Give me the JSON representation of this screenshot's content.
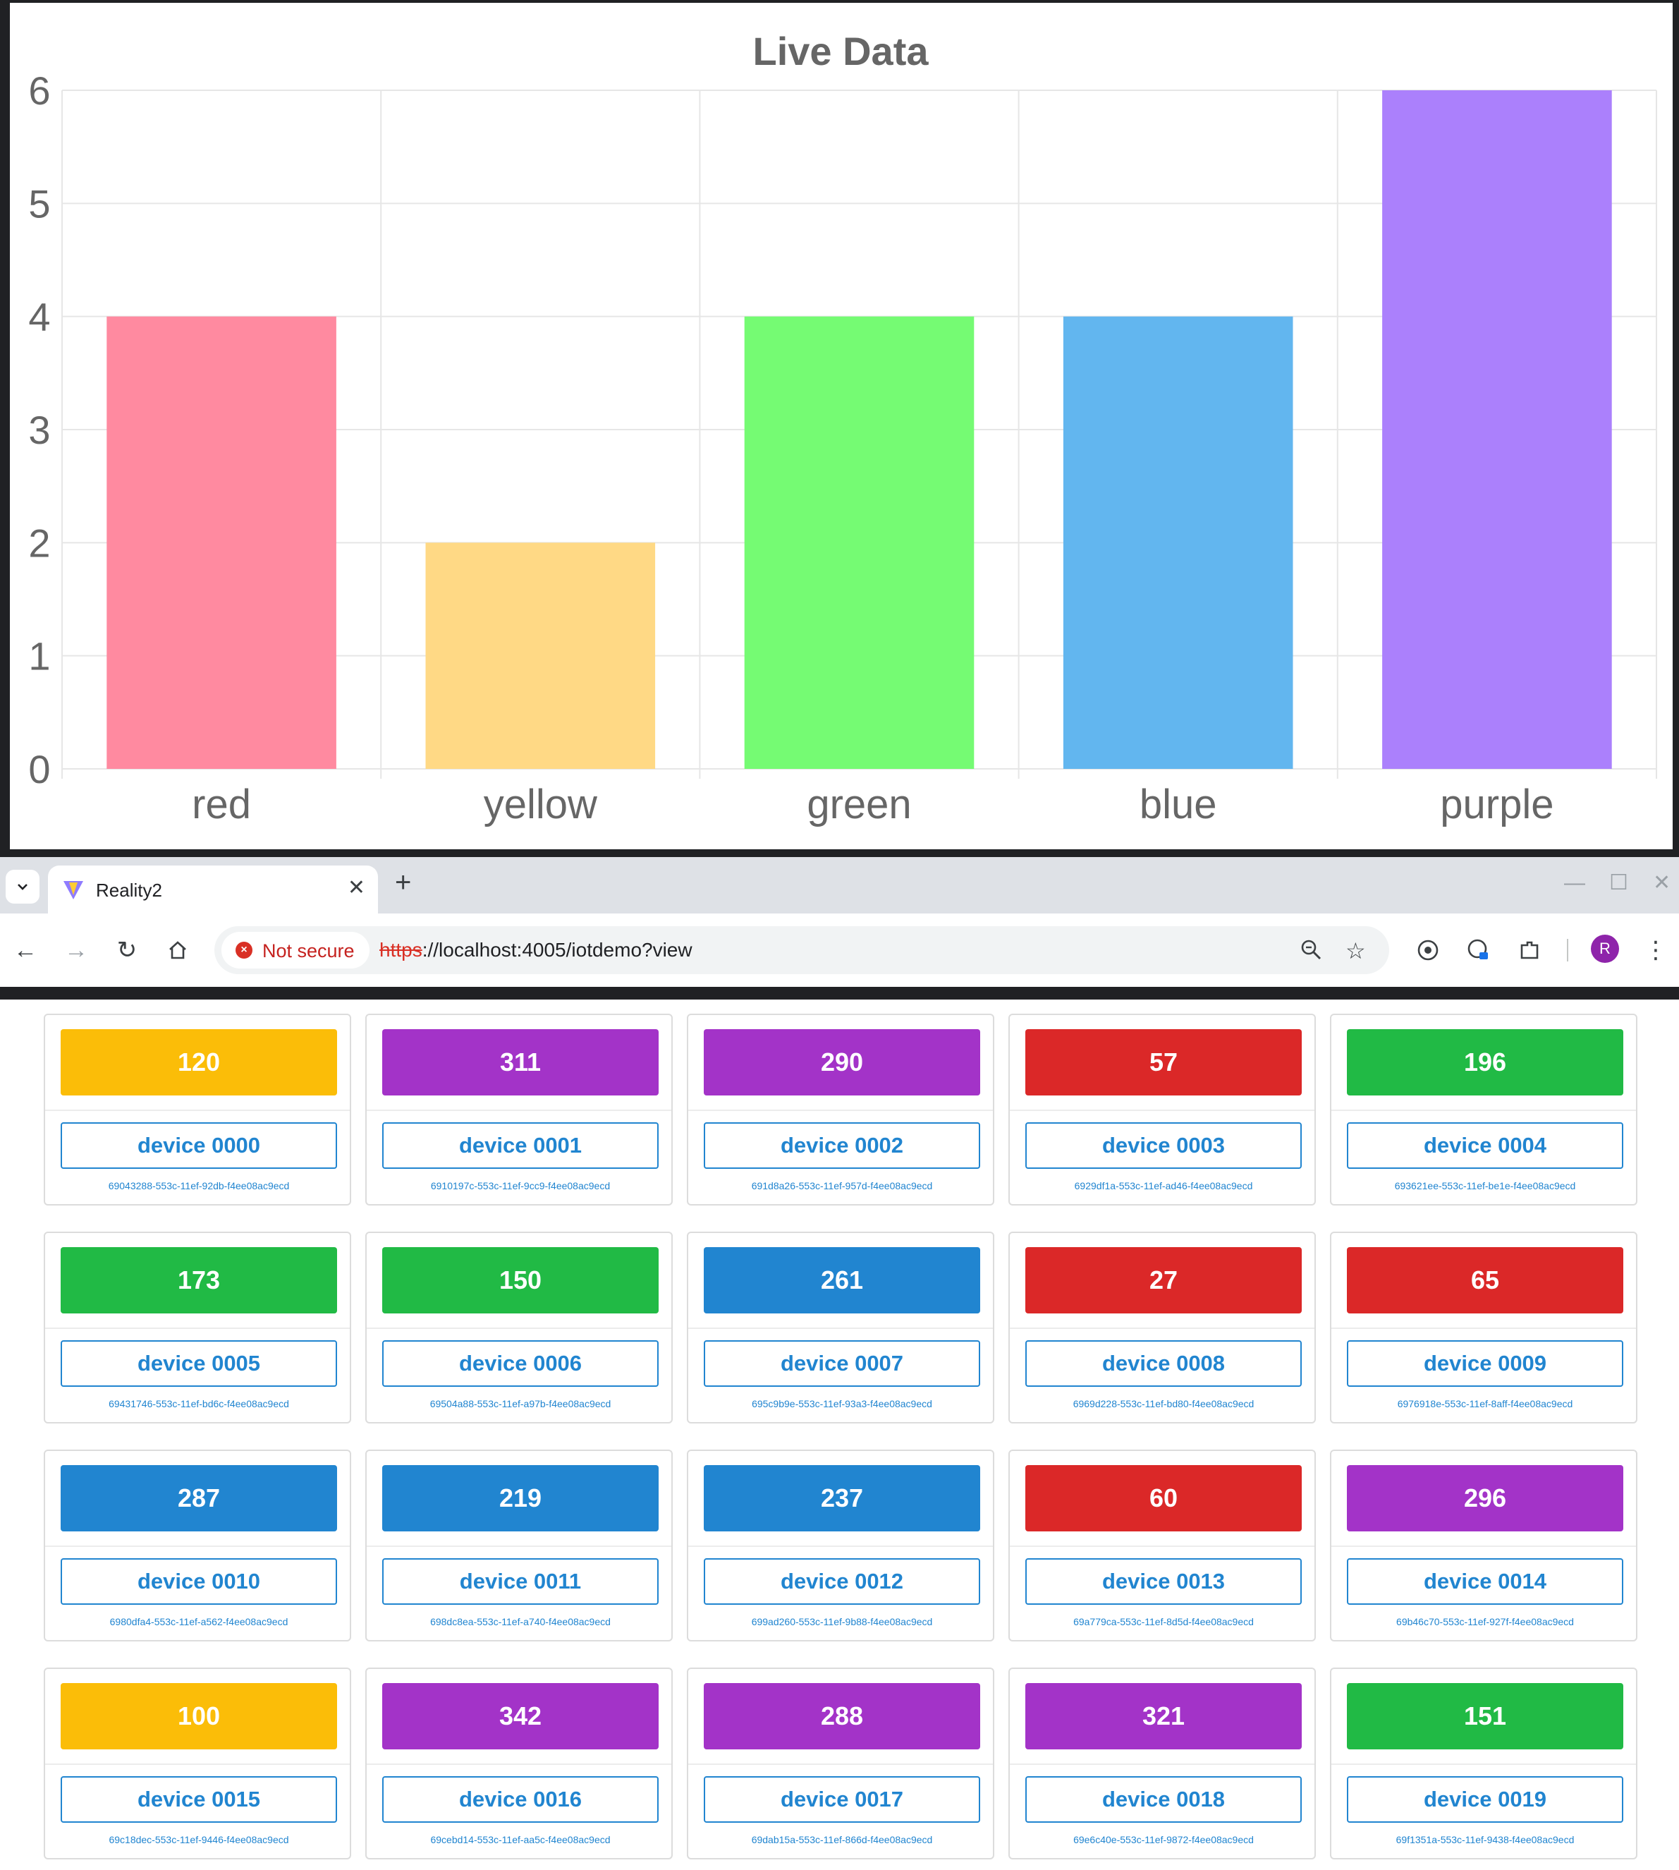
{
  "chart_data": {
    "type": "bar",
    "title": "Live Data",
    "categories": [
      "red",
      "yellow",
      "green",
      "blue",
      "purple"
    ],
    "values": [
      4,
      2,
      4,
      4,
      6
    ],
    "colors": [
      "#ff8aa0",
      "#ffd985",
      "#75fb73",
      "#62b6ef",
      "#ab80fc"
    ],
    "ylim": [
      0,
      6
    ],
    "yticks": [
      0,
      1,
      2,
      3,
      4,
      5,
      6
    ],
    "grid": true,
    "xlabel": "",
    "ylabel": ""
  },
  "browser": {
    "tab_title": "Reality2",
    "security_label": "Not secure",
    "url_scheme": "https",
    "url_rest": "://localhost:4005/iotdemo?view",
    "profile_initial": "R"
  },
  "devices": [
    {
      "value": "120",
      "color": "#fbbd08",
      "name": "device 0000",
      "uuid": "69043288-553c-11ef-92db-f4ee08ac9ecd"
    },
    {
      "value": "311",
      "color": "#a333c8",
      "name": "device 0001",
      "uuid": "6910197c-553c-11ef-9cc9-f4ee08ac9ecd"
    },
    {
      "value": "290",
      "color": "#a333c8",
      "name": "device 0002",
      "uuid": "691d8a26-553c-11ef-957d-f4ee08ac9ecd"
    },
    {
      "value": "57",
      "color": "#db2828",
      "name": "device 0003",
      "uuid": "6929df1a-553c-11ef-ad46-f4ee08ac9ecd"
    },
    {
      "value": "196",
      "color": "#21ba45",
      "name": "device 0004",
      "uuid": "693621ee-553c-11ef-be1e-f4ee08ac9ecd"
    },
    {
      "value": "173",
      "color": "#21ba45",
      "name": "device 0005",
      "uuid": "69431746-553c-11ef-bd6c-f4ee08ac9ecd"
    },
    {
      "value": "150",
      "color": "#21ba45",
      "name": "device 0006",
      "uuid": "69504a88-553c-11ef-a97b-f4ee08ac9ecd"
    },
    {
      "value": "261",
      "color": "#2185d0",
      "name": "device 0007",
      "uuid": "695c9b9e-553c-11ef-93a3-f4ee08ac9ecd"
    },
    {
      "value": "27",
      "color": "#db2828",
      "name": "device 0008",
      "uuid": "6969d228-553c-11ef-bd80-f4ee08ac9ecd"
    },
    {
      "value": "65",
      "color": "#db2828",
      "name": "device 0009",
      "uuid": "6976918e-553c-11ef-8aff-f4ee08ac9ecd"
    },
    {
      "value": "287",
      "color": "#2185d0",
      "name": "device 0010",
      "uuid": "6980dfa4-553c-11ef-a562-f4ee08ac9ecd"
    },
    {
      "value": "219",
      "color": "#2185d0",
      "name": "device 0011",
      "uuid": "698dc8ea-553c-11ef-a740-f4ee08ac9ecd"
    },
    {
      "value": "237",
      "color": "#2185d0",
      "name": "device 0012",
      "uuid": "699ad260-553c-11ef-9b88-f4ee08ac9ecd"
    },
    {
      "value": "60",
      "color": "#db2828",
      "name": "device 0013",
      "uuid": "69a779ca-553c-11ef-8d5d-f4ee08ac9ecd"
    },
    {
      "value": "296",
      "color": "#a333c8",
      "name": "device 0014",
      "uuid": "69b46c70-553c-11ef-927f-f4ee08ac9ecd"
    },
    {
      "value": "100",
      "color": "#fbbd08",
      "name": "device 0015",
      "uuid": "69c18dec-553c-11ef-9446-f4ee08ac9ecd"
    },
    {
      "value": "342",
      "color": "#a333c8",
      "name": "device 0016",
      "uuid": "69cebd14-553c-11ef-aa5c-f4ee08ac9ecd"
    },
    {
      "value": "288",
      "color": "#a333c8",
      "name": "device 0017",
      "uuid": "69dab15a-553c-11ef-866d-f4ee08ac9ecd"
    },
    {
      "value": "321",
      "color": "#a333c8",
      "name": "device 0018",
      "uuid": "69e6c40e-553c-11ef-9872-f4ee08ac9ecd"
    },
    {
      "value": "151",
      "color": "#21ba45",
      "name": "device 0019",
      "uuid": "69f1351a-553c-11ef-9438-f4ee08ac9ecd"
    }
  ]
}
